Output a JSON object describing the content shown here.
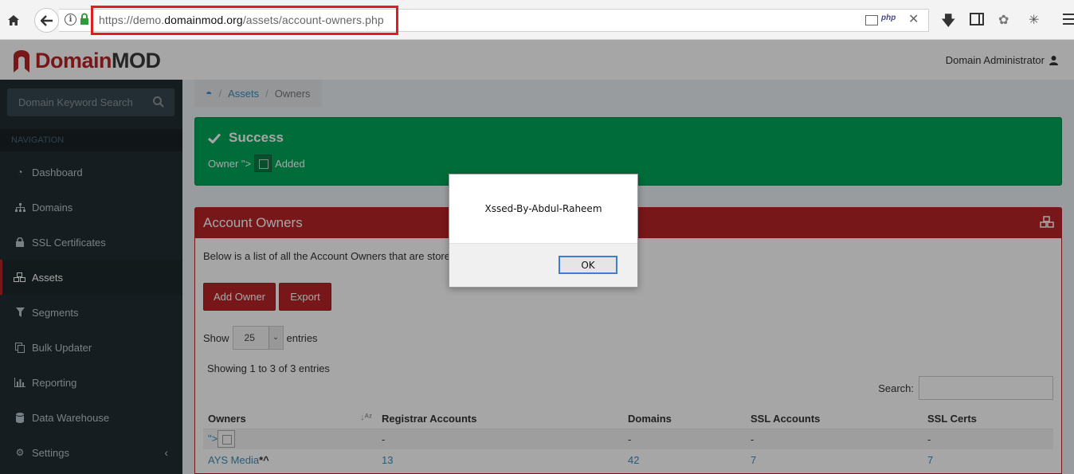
{
  "browser": {
    "url_prefix": "https://demo.",
    "url_domain": "domainmod.org",
    "url_path": "/assets/account-owners.php",
    "php_badge": "php"
  },
  "app": {
    "logo_domain": "Domain",
    "logo_mod": "MOD",
    "user": "Domain Administrator"
  },
  "sidebar": {
    "search_placeholder": "Domain Keyword Search",
    "nav_header": "NAVIGATION",
    "items": [
      {
        "label": "Dashboard",
        "icon": "dashboard-icon"
      },
      {
        "label": "Domains",
        "icon": "sitemap-icon"
      },
      {
        "label": "SSL Certificates",
        "icon": "lock-icon"
      },
      {
        "label": "Assets",
        "icon": "cubes-icon"
      },
      {
        "label": "Segments",
        "icon": "filter-icon"
      },
      {
        "label": "Bulk Updater",
        "icon": "copy-icon"
      },
      {
        "label": "Reporting",
        "icon": "bar-chart-icon"
      },
      {
        "label": "Data Warehouse",
        "icon": "database-icon"
      },
      {
        "label": "Settings",
        "icon": "gears-icon"
      }
    ]
  },
  "breadcrumb": {
    "assets": "Assets",
    "current": "Owners"
  },
  "alert": {
    "title": "Success",
    "msg_prefix": "Owner \">",
    "msg_suffix": "Added"
  },
  "box": {
    "title": "Account Owners",
    "description": "Below is a list of all the Account Owners that are store",
    "add_button": "Add Owner",
    "export_button": "Export",
    "show_label": "Show",
    "entries_label": "entries",
    "page_length": "25",
    "info": "Showing 1 to 3 of 3 entries",
    "search_label": "Search:"
  },
  "table": {
    "headers": [
      "Owners",
      "Registrar Accounts",
      "Domains",
      "SSL Accounts",
      "SSL Certs"
    ],
    "row1": {
      "owner_prefix": "\">",
      "registrar": "-",
      "domains": "-",
      "ssl_accounts": "-",
      "ssl_certs": "-"
    },
    "row2": {
      "owner": "AYS Media",
      "owner_mark": "*^",
      "registrar": "13",
      "domains": "42",
      "ssl_accounts": "7",
      "ssl_certs": "7"
    }
  },
  "dialog": {
    "message": "Xssed-By-Abdul-Raheem",
    "ok": "OK"
  },
  "colors": {
    "brand": "#b82427",
    "success": "#00a65a",
    "sidebar": "#222d32",
    "link": "#3c8dbc",
    "url_highlight": "#e21c23"
  }
}
